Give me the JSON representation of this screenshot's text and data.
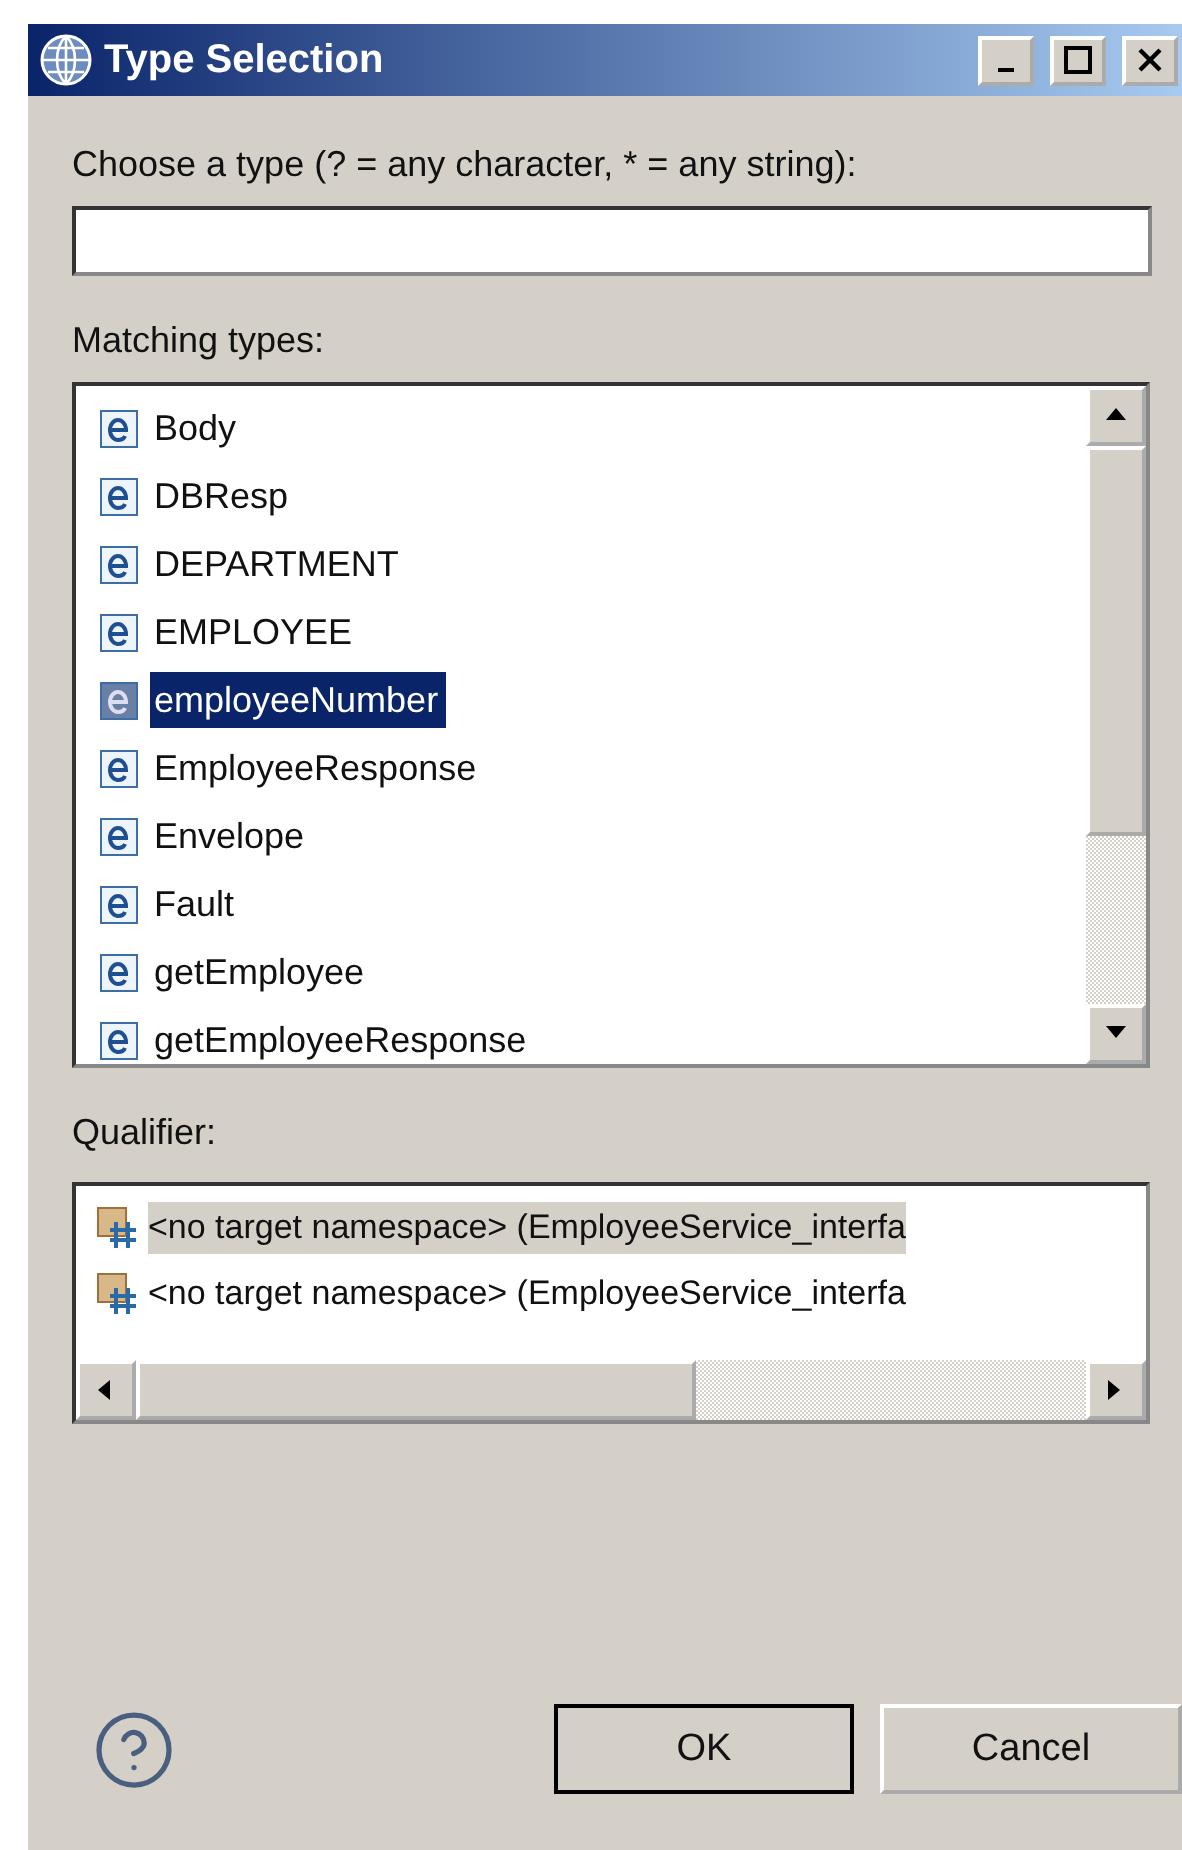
{
  "window": {
    "title": "Type Selection"
  },
  "filter": {
    "label": "Choose a type (? = any character, * = any string):"
  },
  "matching": {
    "label": "Matching types:",
    "items": [
      {
        "name": "Body",
        "selected": false
      },
      {
        "name": "DBResp",
        "selected": false
      },
      {
        "name": "DEPARTMENT",
        "selected": false
      },
      {
        "name": "EMPLOYEE",
        "selected": false
      },
      {
        "name": "employeeNumber",
        "selected": true
      },
      {
        "name": "EmployeeResponse",
        "selected": false
      },
      {
        "name": "Envelope",
        "selected": false
      },
      {
        "name": "Fault",
        "selected": false
      },
      {
        "name": "getEmployee",
        "selected": false
      },
      {
        "name": "getEmployeeResponse",
        "selected": false
      }
    ]
  },
  "qualifier": {
    "label": "Qualifier:",
    "items": [
      {
        "text": "<no target namespace> (EmployeeService_interfa",
        "selected": true
      },
      {
        "text": "<no target namespace> (EmployeeService_interfa",
        "selected": false
      }
    ]
  },
  "buttons": [
    {
      "label": "OK",
      "default": true
    },
    {
      "label": "Cancel",
      "default": false
    }
  ]
}
